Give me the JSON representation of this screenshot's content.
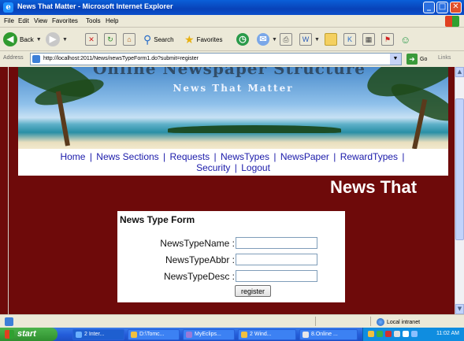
{
  "window": {
    "title": "News That Matter - Microsoft Internet Explorer",
    "minimize": "_",
    "maximize": "□",
    "close": "✕"
  },
  "menu": [
    "File",
    "Edit",
    "View",
    "Favorites",
    "Tools",
    "Help"
  ],
  "toolbar": {
    "back_label": "Back",
    "search_label": "Search",
    "favorites_label": "Favorites"
  },
  "address": {
    "label": "Address",
    "url": "http://localhost:2011/News/newsTypeForm1.do?submit=register",
    "go_label": "Go",
    "links_label": "Links"
  },
  "banner": {
    "faded_title": "Online Newspaper Structure",
    "subtitle": "News That Matter"
  },
  "nav": {
    "items": [
      "Home",
      "News Sections",
      "Requests",
      "NewsTypes",
      "NewsPaper",
      "RewardTypes",
      "Security",
      "Logout"
    ],
    "separator": "|"
  },
  "hero_text": "News That",
  "form": {
    "title": "News Type Form",
    "fields": [
      {
        "label": "NewsTypeName :",
        "value": ""
      },
      {
        "label": "NewsTypeAbbr :",
        "value": ""
      },
      {
        "label": "NewsTypeDesc :",
        "value": ""
      }
    ],
    "submit_label": "register"
  },
  "status": {
    "zone": "Local intranet"
  },
  "taskbar": {
    "start_label": "start",
    "tasks": [
      {
        "label": "2 Inter..."
      },
      {
        "label": "D:\\Tomc..."
      },
      {
        "label": "MyEclips..."
      },
      {
        "label": "2 Wind..."
      },
      {
        "label": "8.Online ..."
      }
    ],
    "clock": "11:02 AM"
  },
  "colors": {
    "page_background": "#6e0a0a",
    "nav_link": "#1a1aaa",
    "xp_blue": "#0a4fcc",
    "xp_green": "#2f8f2f"
  }
}
